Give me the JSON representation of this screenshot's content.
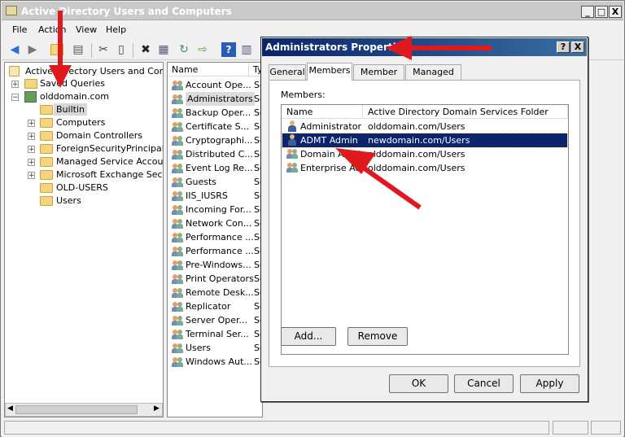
{
  "window": {
    "title": "Active Directory Users and Computers",
    "minimize": "_",
    "maximize": "□",
    "close": "X"
  },
  "menu": [
    "File",
    "Action",
    "View",
    "Help"
  ],
  "tree": {
    "root": "Active Directory Users and Comput",
    "saved_queries": "Saved Queries",
    "domain": "olddomain.com",
    "children": [
      "Builtin",
      "Computers",
      "Domain Controllers",
      "ForeignSecurityPrincipals",
      "Managed Service Accounts",
      "Microsoft Exchange Securit",
      "OLD-USERS",
      "Users"
    ]
  },
  "list": {
    "columns": [
      "Name",
      "Ty"
    ],
    "items": [
      {
        "name": "Account Ope...",
        "type": "Se"
      },
      {
        "name": "Administrators",
        "type": "Se"
      },
      {
        "name": "Backup Oper...",
        "type": "Se"
      },
      {
        "name": "Certificate S...",
        "type": "Se"
      },
      {
        "name": "Cryptographi...",
        "type": "Se"
      },
      {
        "name": "Distributed C...",
        "type": "Se"
      },
      {
        "name": "Event Log Re...",
        "type": "Se"
      },
      {
        "name": "Guests",
        "type": "Se"
      },
      {
        "name": "IIS_IUSRS",
        "type": "Se"
      },
      {
        "name": "Incoming For...",
        "type": "Se"
      },
      {
        "name": "Network Con...",
        "type": "Se"
      },
      {
        "name": "Performance ...",
        "type": "Se"
      },
      {
        "name": "Performance ...",
        "type": "Se"
      },
      {
        "name": "Pre-Windows...",
        "type": "Se"
      },
      {
        "name": "Print Operators",
        "type": "Se"
      },
      {
        "name": "Remote Desk...",
        "type": "Se"
      },
      {
        "name": "Replicator",
        "type": "Se"
      },
      {
        "name": "Server Oper...",
        "type": "Se"
      },
      {
        "name": "Terminal Ser...",
        "type": "Se"
      },
      {
        "name": "Users",
        "type": "Se"
      },
      {
        "name": "Windows Aut...",
        "type": "Se"
      }
    ]
  },
  "dialog": {
    "title": "Administrators Properties",
    "help": "?",
    "close": "X",
    "tabs": [
      "General",
      "Members",
      "Member Of",
      "Managed By"
    ],
    "members_label": "Members:",
    "columns": [
      "Name",
      "Active Directory Domain Services Folder"
    ],
    "members": [
      {
        "name": "Administrator",
        "folder": "olddomain.com/Users",
        "kind": "user"
      },
      {
        "name": "ADMT Admin",
        "folder": "newdomain.com/Users",
        "kind": "user"
      },
      {
        "name": "Domain Admins",
        "folder": "olddomain.com/Users",
        "kind": "group"
      },
      {
        "name": "Enterprise Ad...",
        "folder": "olddomain.com/Users",
        "kind": "group"
      }
    ],
    "add_label": "Add...",
    "remove_label": "Remove",
    "ok_label": "OK",
    "cancel_label": "Cancel",
    "apply_label": "Apply"
  },
  "colors": {
    "selection": "#0b246b",
    "annotation": "#e0191e"
  }
}
